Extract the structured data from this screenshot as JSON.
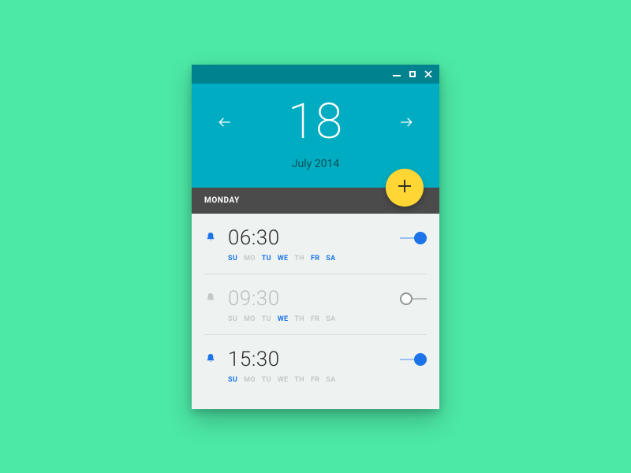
{
  "header": {
    "day_number": "18",
    "month_year": "July 2014"
  },
  "daybar": {
    "label": "MONDAY"
  },
  "day_labels": [
    "SU",
    "MO",
    "TU",
    "WE",
    "TH",
    "FR",
    "SA"
  ],
  "alarms": [
    {
      "time": "06:30",
      "active": true,
      "days_on": [
        0,
        2,
        3,
        5,
        6
      ]
    },
    {
      "time": "09:30",
      "active": false,
      "days_on": [
        3
      ]
    },
    {
      "time": "15:30",
      "active": true,
      "days_on": [
        0
      ]
    }
  ],
  "colors": {
    "accent": "#1c74e8",
    "fab": "#ffd633",
    "header": "#00acc1",
    "titlebar": "#00838f"
  }
}
